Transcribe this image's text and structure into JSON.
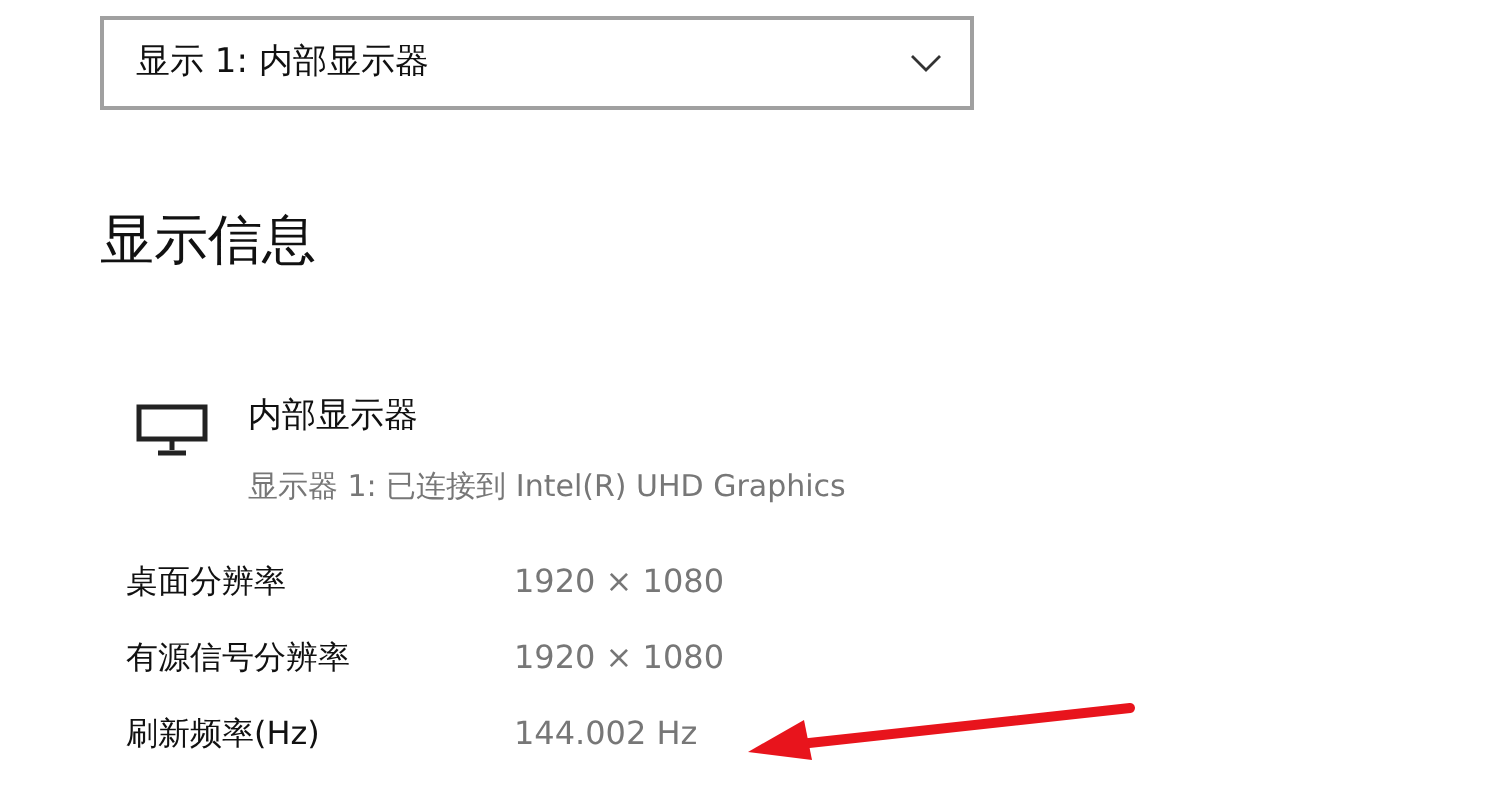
{
  "display_select": {
    "value": "显示 1: 内部显示器"
  },
  "section_title": "显示信息",
  "monitor": {
    "name": "内部显示器",
    "detail": "显示器 1: 已连接到 Intel(R) UHD Graphics"
  },
  "rows": [
    {
      "label": "桌面分辨率",
      "value": "1920 × 1080"
    },
    {
      "label": "有源信号分辨率",
      "value": "1920 × 1080"
    },
    {
      "label": "刷新频率(Hz)",
      "value": "144.002 Hz"
    }
  ],
  "annotation": {
    "kind": "arrow"
  }
}
